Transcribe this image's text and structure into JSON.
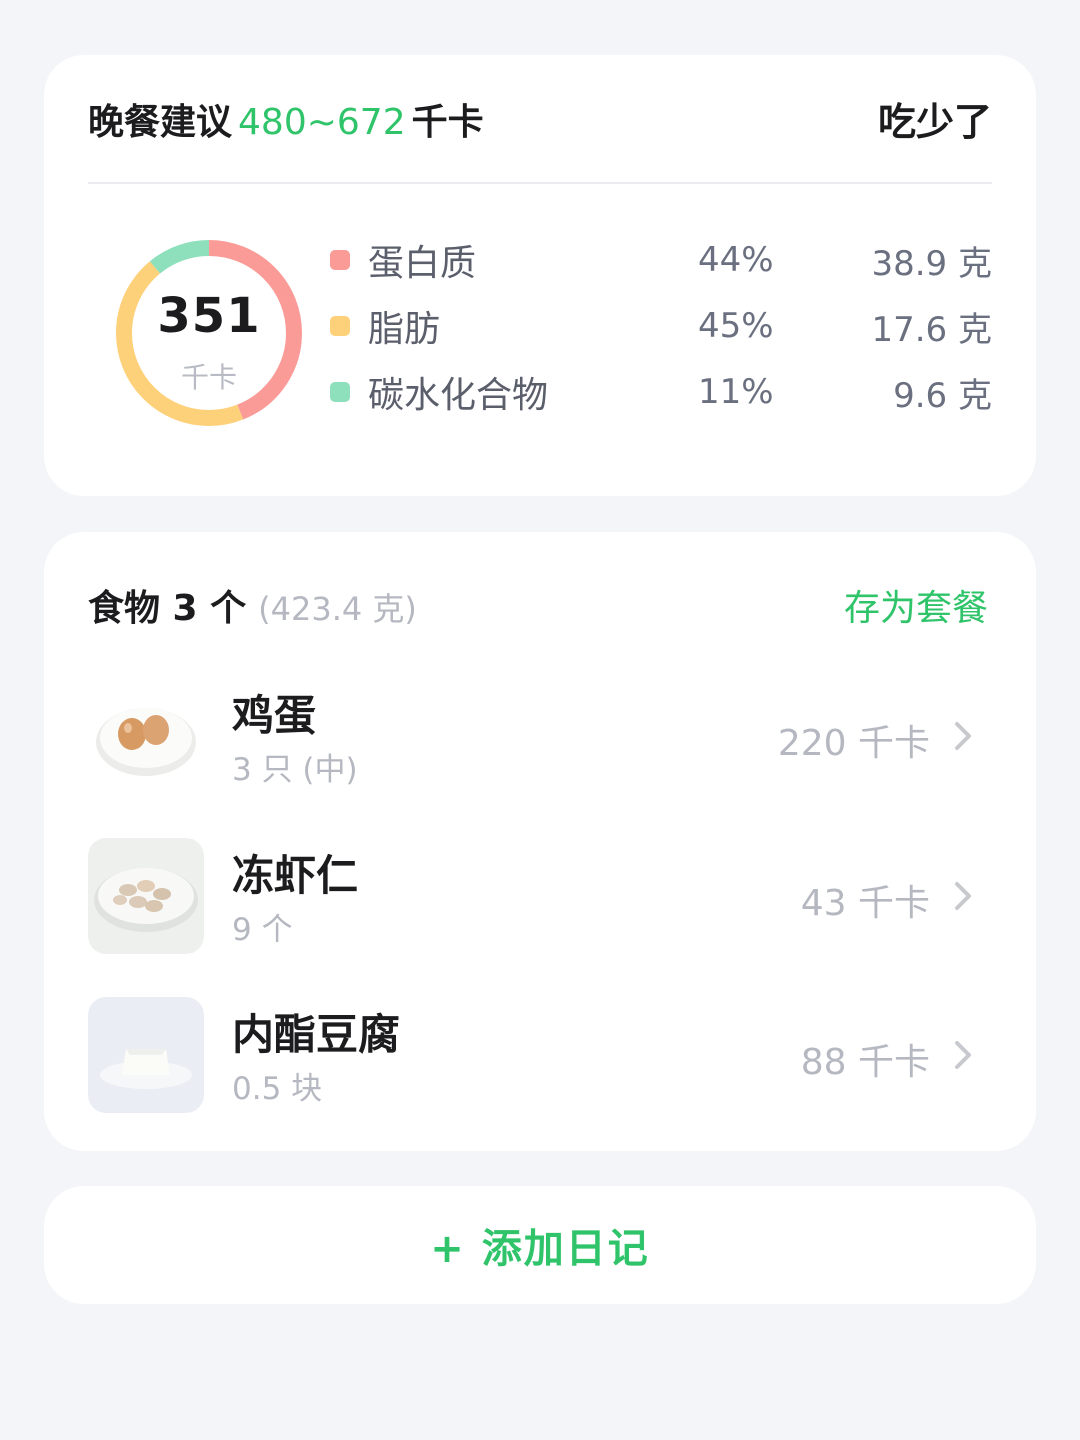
{
  "summary": {
    "title_prefix": "晚餐建议",
    "kcal_range": "480~672",
    "kcal_unit": "千卡",
    "status": "吃少了",
    "total_value": "351",
    "total_unit": "千卡",
    "macros": [
      {
        "name": "蛋白质",
        "percent": "44%",
        "grams": "38.9 克",
        "color": "#fa9b97",
        "fraction": 0.44
      },
      {
        "name": "脂肪",
        "percent": "45%",
        "grams": "17.6 克",
        "color": "#fdd07a",
        "fraction": 0.45
      },
      {
        "name": "碳水化合物",
        "percent": "11%",
        "grams": "9.6 克",
        "color": "#8ee0bc",
        "fraction": 0.11
      }
    ]
  },
  "food": {
    "title": "食物 3 个",
    "total_weight": "(423.4 克)",
    "save_label": "存为套餐",
    "items": [
      {
        "name": "鸡蛋",
        "qty": "3 只 (中)",
        "kcal": "220 千卡",
        "thumb_icon": "egg-plate-icon"
      },
      {
        "name": "冻虾仁",
        "qty": "9 个",
        "kcal": "43 千卡",
        "thumb_icon": "shrimp-plate-icon"
      },
      {
        "name": "内酯豆腐",
        "qty": "0.5 块",
        "kcal": "88 千卡",
        "thumb_icon": "tofu-plate-icon"
      }
    ]
  },
  "actions": {
    "add_diary": "+ 添加日记"
  },
  "colors": {
    "accent_green": "#2fc46a",
    "background": "#f4f5f8"
  }
}
